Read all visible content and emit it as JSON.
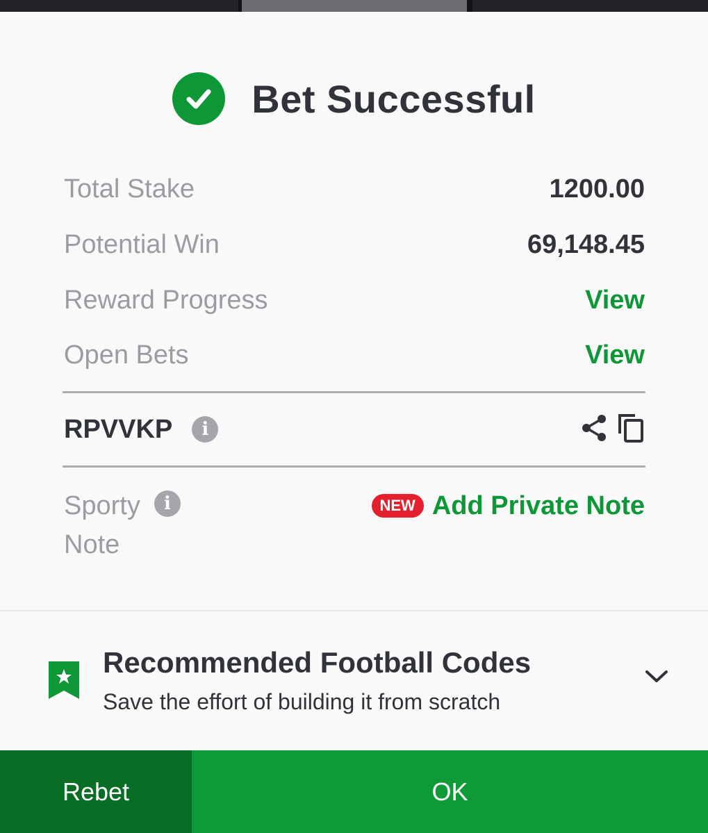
{
  "dialog": {
    "title": "Bet Successful"
  },
  "summary": {
    "total_stake_label": "Total Stake",
    "total_stake_value": "1200.00",
    "potential_win_label": "Potential Win",
    "potential_win_value": "69,148.45",
    "reward_progress_label": "Reward Progress",
    "reward_progress_link": "View",
    "open_bets_label": "Open Bets",
    "open_bets_link": "View"
  },
  "booking": {
    "code": "RPVVKP"
  },
  "note": {
    "label": "Sporty Note",
    "badge": "NEW",
    "action": "Add Private Note"
  },
  "recommended": {
    "title": "Recommended Football Codes",
    "subtitle": "Save the effort of building it from scratch"
  },
  "footer": {
    "rebet_label": "Rebet",
    "ok_label": "OK"
  },
  "colors": {
    "accent": "#0d9737",
    "badge": "#e41f2e",
    "rebet_bg": "#0a6d26",
    "ok_bg": "#0e9a36"
  },
  "icons": [
    "check-circle-icon",
    "info-icon",
    "share-icon",
    "copy-icon",
    "bookmark-star-icon",
    "chevron-down-icon"
  ]
}
